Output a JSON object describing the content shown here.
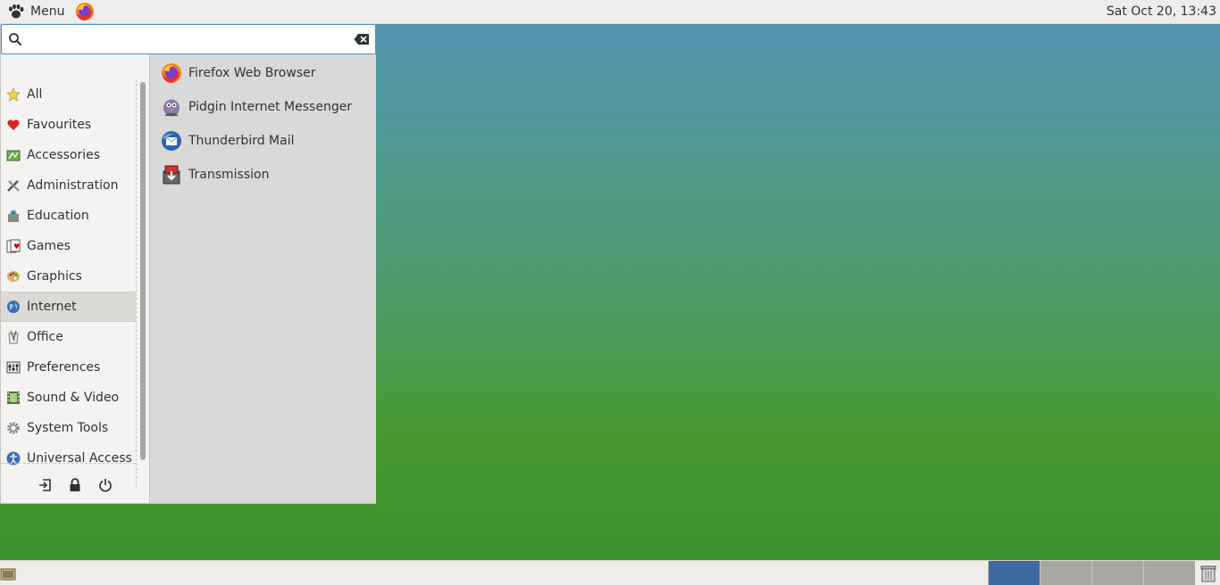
{
  "top_panel": {
    "menu_label": "Menu",
    "launcher_icon": "firefox-icon",
    "clock": "Sat Oct 20, 13:43"
  },
  "search": {
    "placeholder": "",
    "value": ""
  },
  "categories": [
    {
      "label": "All",
      "icon": "star-icon"
    },
    {
      "label": "Favourites",
      "icon": "heart-icon"
    },
    {
      "label": "Accessories",
      "icon": "accessories-icon"
    },
    {
      "label": "Administration",
      "icon": "tools-icon"
    },
    {
      "label": "Education",
      "icon": "education-icon"
    },
    {
      "label": "Games",
      "icon": "games-icon"
    },
    {
      "label": "Graphics",
      "icon": "palette-icon"
    },
    {
      "label": "Internet",
      "icon": "globe-icon",
      "selected": true
    },
    {
      "label": "Office",
      "icon": "office-icon"
    },
    {
      "label": "Preferences",
      "icon": "preferences-icon"
    },
    {
      "label": "Sound & Video",
      "icon": "film-icon"
    },
    {
      "label": "System Tools",
      "icon": "gear-icon"
    },
    {
      "label": "Universal Access",
      "icon": "accessibility-icon"
    }
  ],
  "apps": [
    {
      "label": "Firefox Web Browser",
      "icon": "firefox-icon"
    },
    {
      "label": "Pidgin Internet Messenger",
      "icon": "pidgin-icon"
    },
    {
      "label": "Thunderbird Mail",
      "icon": "thunderbird-icon"
    },
    {
      "label": "Transmission",
      "icon": "transmission-icon"
    }
  ],
  "actions": [
    {
      "name": "logout-icon"
    },
    {
      "name": "lock-icon"
    },
    {
      "name": "power-icon"
    }
  ],
  "workspaces": {
    "count": 4,
    "active_index": 0
  },
  "colors": {
    "accent": "#4a90d9",
    "workspace_active": "#3d6aa0",
    "panel_bg": "#efedeb"
  }
}
